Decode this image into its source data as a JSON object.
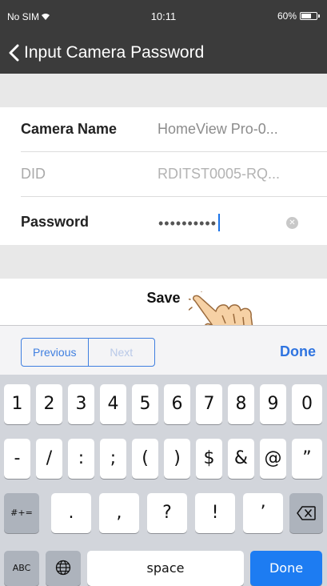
{
  "status": {
    "carrier": "No SIM",
    "time": "10:11",
    "battery": "60%"
  },
  "nav": {
    "title": "Input Camera Password"
  },
  "form": {
    "camera_name_label": "Camera Name",
    "camera_name_value": "HomeView Pro-0...",
    "did_label": "DID",
    "did_value": "RDITST0005-RQ...",
    "password_label": "Password",
    "password_mask": "••••••••••"
  },
  "save_label": "Save",
  "accessory": {
    "previous": "Previous",
    "next": "Next",
    "done": "Done"
  },
  "keyboard": {
    "row1": [
      "1",
      "2",
      "3",
      "4",
      "5",
      "6",
      "7",
      "8",
      "9",
      "0"
    ],
    "row2": [
      "-",
      "/",
      ":",
      ";",
      "(",
      ")",
      "$",
      "&",
      "@",
      "”"
    ],
    "row3_mode": "#+=",
    "row3": [
      ".",
      ",",
      "?",
      "!",
      "’"
    ],
    "abc": "ABC",
    "space": "space",
    "done": "Done"
  },
  "colors": {
    "nav_bg": "#3b3b3b",
    "accent": "#2f74e0",
    "done_key": "#1d7cf2",
    "keyboard_bg": "#d2d5db"
  }
}
